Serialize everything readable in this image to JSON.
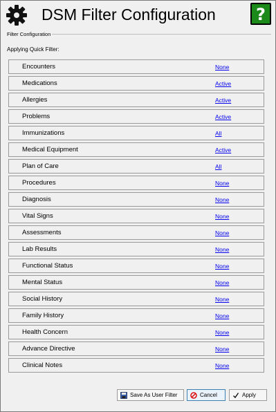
{
  "header": {
    "title": "DSM Filter Configuration",
    "help_glyph": "?",
    "settings_icon": "gear-icon",
    "help_icon": "help-icon"
  },
  "group": {
    "label": "Filter Configuration"
  },
  "quick_filter_label": "Applying Quick Filter:",
  "filters": [
    {
      "label": "Encounters",
      "status": "None"
    },
    {
      "label": "Medications",
      "status": "Active"
    },
    {
      "label": "Allergies",
      "status": "Active"
    },
    {
      "label": "Problems",
      "status": "Active"
    },
    {
      "label": "Immunizations",
      "status": "All"
    },
    {
      "label": "Medical Equipment",
      "status": "Active"
    },
    {
      "label": "Plan of Care",
      "status": "All"
    },
    {
      "label": "Procedures",
      "status": "None"
    },
    {
      "label": "Diagnosis",
      "status": "None"
    },
    {
      "label": "Vital Signs",
      "status": "None"
    },
    {
      "label": "Assessments",
      "status": "None"
    },
    {
      "label": "Lab Results",
      "status": "None"
    },
    {
      "label": "Functional Status",
      "status": "None"
    },
    {
      "label": "Mental Status",
      "status": "None"
    },
    {
      "label": "Social History",
      "status": "None"
    },
    {
      "label": "Family History",
      "status": "None"
    },
    {
      "label": "Health Concern",
      "status": "None"
    },
    {
      "label": "Advance Directive",
      "status": "None"
    },
    {
      "label": "Clinical Notes",
      "status": "None"
    }
  ],
  "buttons": {
    "save_label": "Save As User Filter",
    "cancel_label": "Cancel",
    "apply_label": "Apply"
  },
  "colors": {
    "link": "#0000ee",
    "help_bg": "#1b8a1b",
    "window_bg": "#f0f0f0"
  }
}
